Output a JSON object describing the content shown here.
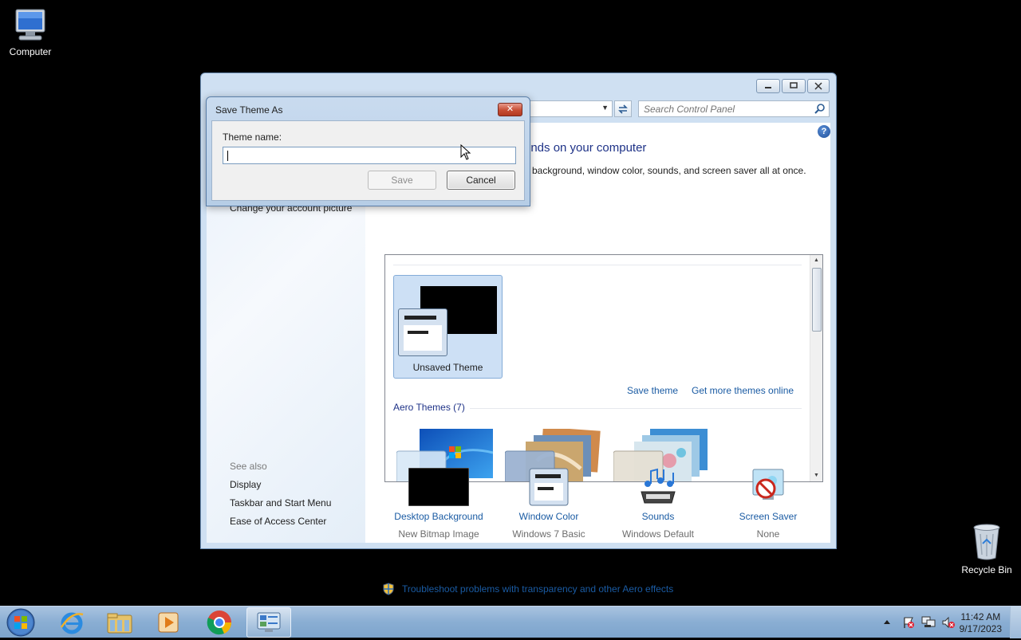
{
  "desktop": {
    "icons": [
      {
        "label": "Computer"
      },
      {
        "label": "Recycle Bin"
      }
    ]
  },
  "window": {
    "search_placeholder": "Search Control Panel",
    "help": "?",
    "heading": "unds on your computer",
    "subheading": "p background, window color, sounds, and screen saver all at once.",
    "left_pane": {
      "account_link": "Change your account picture",
      "see_also": "See also",
      "links": [
        "Display",
        "Taskbar and Start Menu",
        "Ease of Access Center"
      ]
    },
    "themes": {
      "unsaved_label": "Unsaved Theme",
      "save_theme": "Save theme",
      "get_more": "Get more themes online",
      "aero_header": "Aero Themes (7)"
    },
    "bottom": [
      {
        "name": "Desktop Background",
        "value": "New Bitmap Image"
      },
      {
        "name": "Window Color",
        "value": "Windows 7 Basic"
      },
      {
        "name": "Sounds",
        "value": "Windows Default"
      },
      {
        "name": "Screen Saver",
        "value": "None"
      }
    ],
    "troubleshoot": "Troubleshoot problems with transparency and other Aero effects"
  },
  "dialog": {
    "title": "Save Theme As",
    "close": "✕",
    "field_label": "Theme name:",
    "field_value": "",
    "save": "Save",
    "cancel": "Cancel"
  },
  "taskbar": {
    "time": "11:42 AM",
    "date": "9/17/2023",
    "items": [
      "internet-explorer-icon",
      "file-explorer-icon",
      "media-player-icon",
      "chrome-icon",
      "control-panel-icon"
    ]
  },
  "colors": {
    "link": "#1a5ba3",
    "heading": "#1e3287",
    "taskbar": "#8aaed3"
  }
}
